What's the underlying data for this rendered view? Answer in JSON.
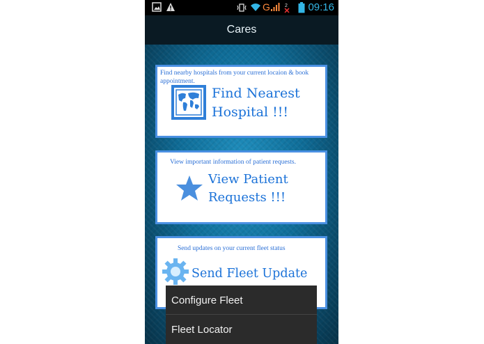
{
  "status": {
    "time": "09:16",
    "network": "G"
  },
  "actionbar": {
    "title": "Cares"
  },
  "cards": [
    {
      "desc": "Find nearby hospitals  from your current locaion & book appointment.",
      "line1": "Find Nearest",
      "line2": "Hospital !!!",
      "icon": "world-map-icon"
    },
    {
      "desc": "View important information of patient requests.",
      "line1": "View Patient",
      "line2": "Requests !!!",
      "icon": "star-icon"
    },
    {
      "desc": "Send updates on your current fleet status",
      "line1": "Send Fleet Update !!!",
      "icon": "gear-icon"
    }
  ],
  "menu": {
    "items": [
      "Configure Fleet",
      "Fleet Locator"
    ]
  },
  "colors": {
    "accent": "#33b5e5",
    "card_border": "#4a90e2",
    "text_blue": "#1b72d8"
  }
}
